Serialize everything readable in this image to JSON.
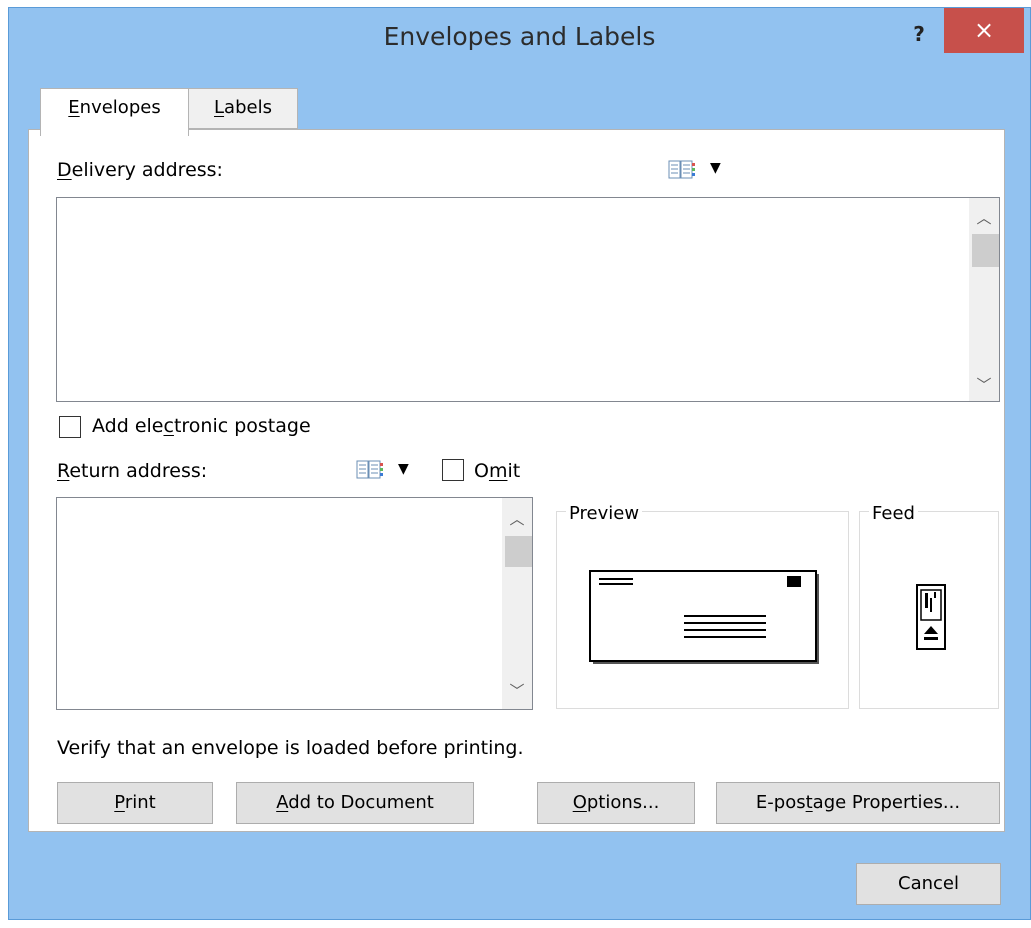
{
  "window": {
    "title": "Envelopes and Labels",
    "help": "?",
    "close": "×"
  },
  "tabs": [
    {
      "label": "Envelopes",
      "accel": "E",
      "rest": "nvelopes",
      "active": true
    },
    {
      "label": "Labels",
      "accel": "L",
      "rest": "abels",
      "active": false
    }
  ],
  "delivery": {
    "label": "Delivery address:",
    "accel": "D",
    "rest": "elivery address:",
    "value": ""
  },
  "postage": {
    "label": "Add electronic postage",
    "pre": "Add ele",
    "accel": "c",
    "post": "tronic postage",
    "checked": false
  },
  "return_address": {
    "label": "Return address:",
    "accel": "R",
    "rest": "eturn address:",
    "value": "",
    "omit_pre": "O",
    "omit_accel": "m",
    "omit_post": "it",
    "omit_checked": false
  },
  "preview": {
    "title": "Preview"
  },
  "feed": {
    "title": "Feed"
  },
  "note": "Verify that an envelope is loaded before printing.",
  "buttons": {
    "print_accel": "P",
    "print_rest": "rint",
    "add_accel": "A",
    "add_rest": "dd to Document",
    "options_accel": "O",
    "options_rest": "ptions...",
    "epost_pre": "E-pos",
    "epost_accel": "t",
    "epost_post": "age Properties...",
    "cancel": "Cancel"
  },
  "icons": {
    "address_book": "address-book-icon",
    "dropdown": "dropdown-arrow-icon",
    "scroll_up": "chevron-up-icon",
    "scroll_down": "chevron-down-icon"
  },
  "colors": {
    "titlebar": "#92c2f0",
    "close": "#c7504b"
  }
}
